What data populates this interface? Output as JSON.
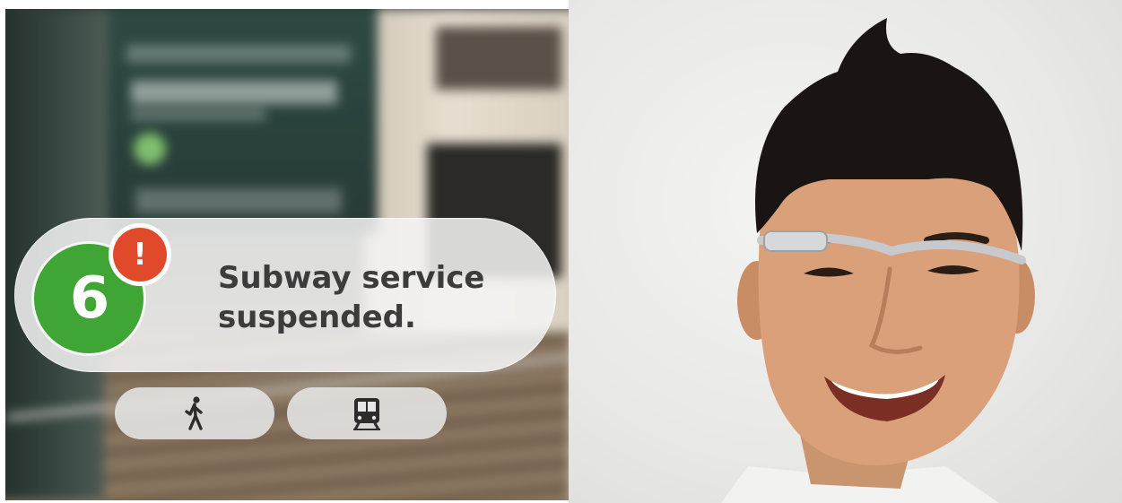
{
  "notification": {
    "route_number": "6",
    "alert_symbol": "!",
    "message_line1": "Subway service",
    "message_line2": "suspended.",
    "route_color": "#3fa535",
    "alert_color": "#e04a2a"
  },
  "actions": [
    {
      "icon": "walking-person-icon"
    },
    {
      "icon": "subway-train-icon"
    }
  ]
}
